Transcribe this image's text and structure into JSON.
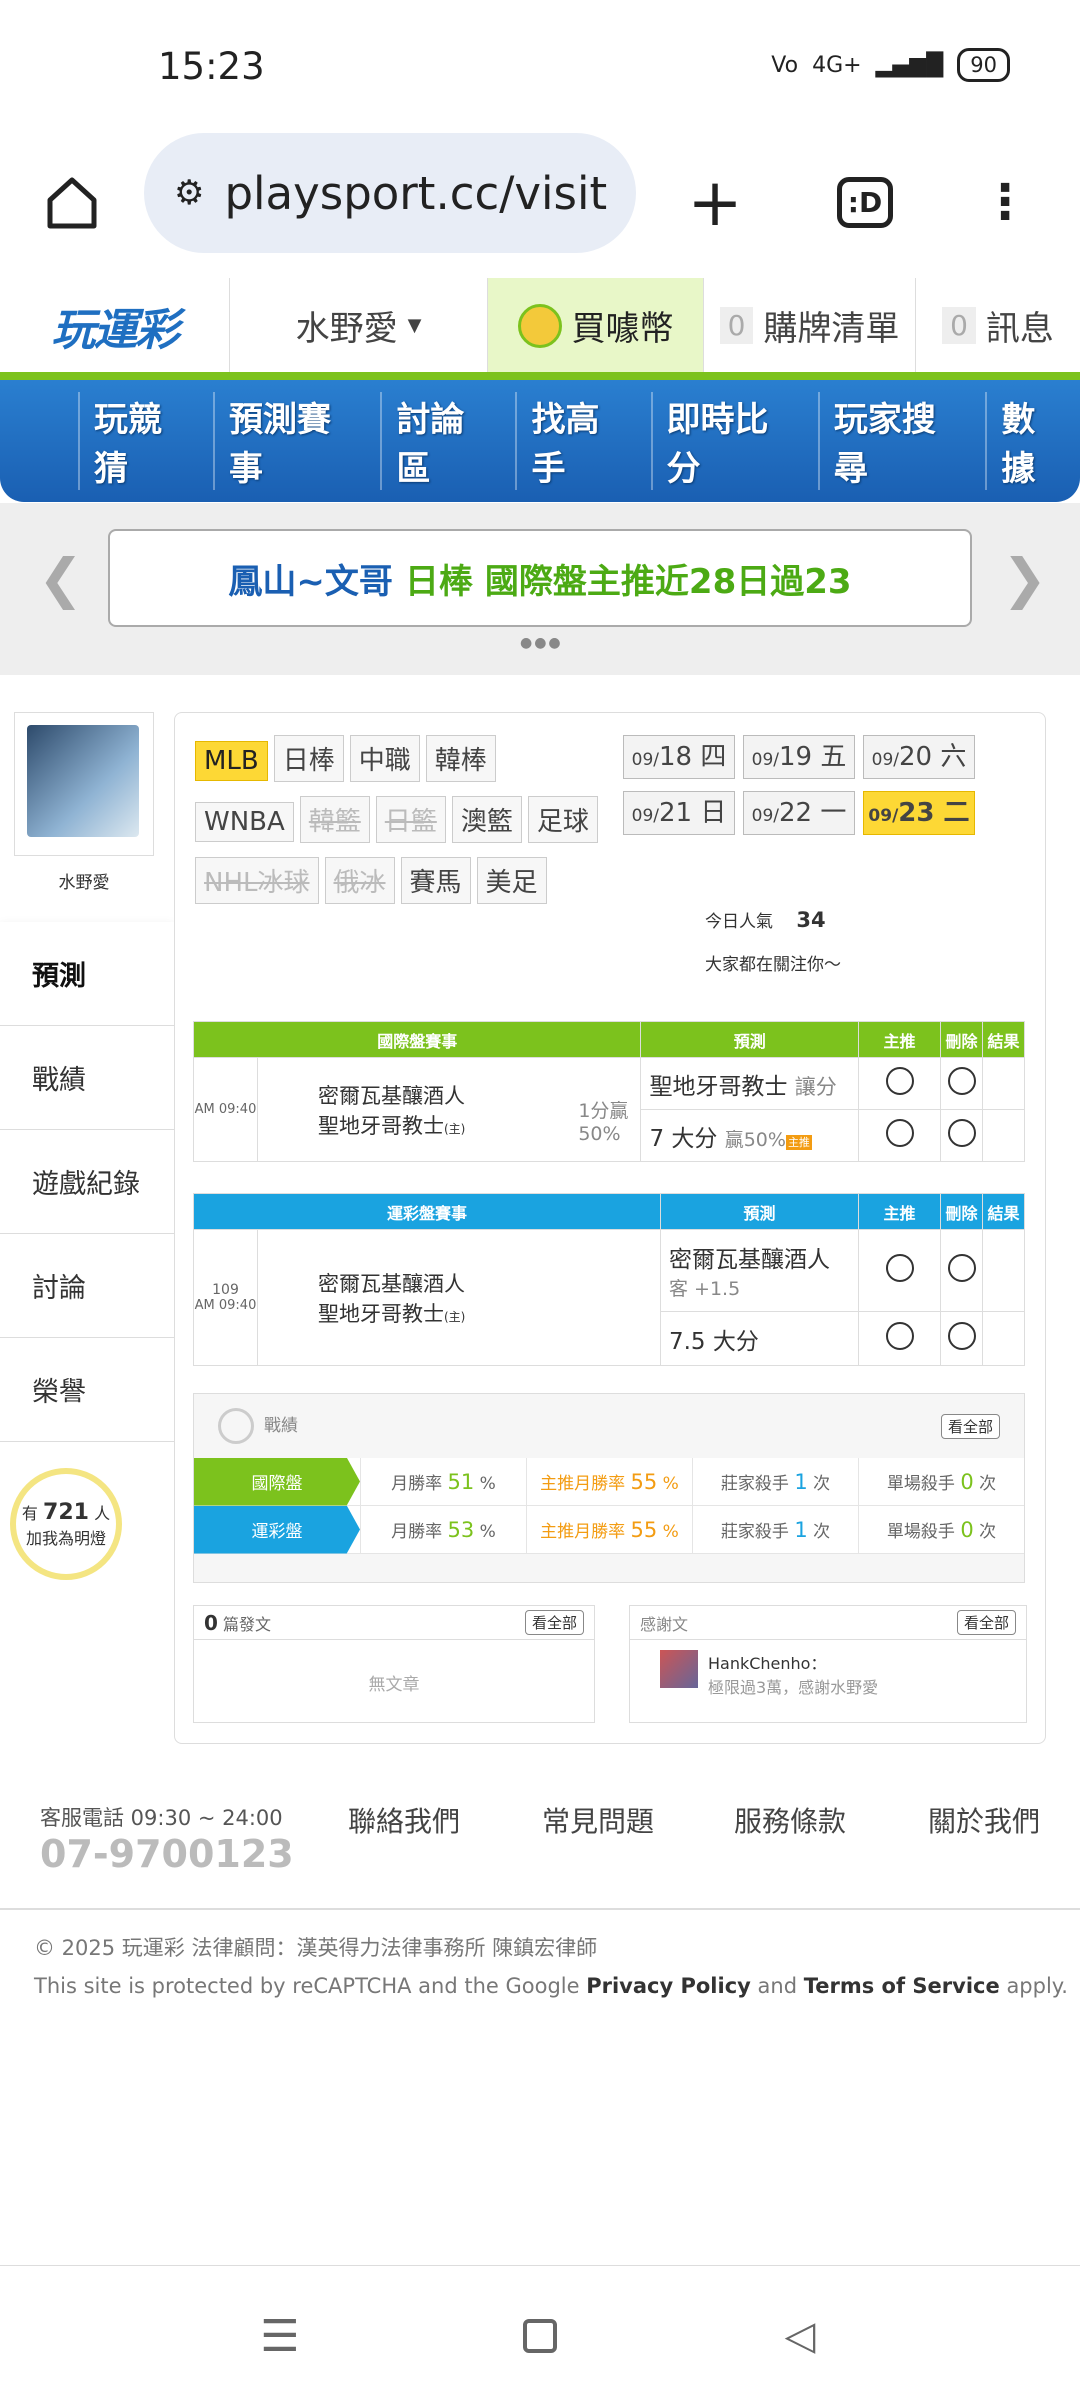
{
  "status": {
    "time": "15:23",
    "network": "4G+",
    "battery": "90"
  },
  "browser": {
    "url": "playsport.cc/visit",
    "tab_icon": ":D"
  },
  "site_header": {
    "logo": "玩運彩",
    "user": "水野愛",
    "buy_coin": "買噱幣",
    "cart_count": "0",
    "cart_label": "購牌清單",
    "msg_count": "0",
    "msg_label": "訊息"
  },
  "main_nav": [
    "玩競猜",
    "預測賽事",
    "討論區",
    "找高手",
    "即時比分",
    "玩家搜尋",
    "數據"
  ],
  "banner": {
    "name": "鳳山~文哥",
    "league": "日棒",
    "text": "國際盤主推近28日過23"
  },
  "profile": {
    "name": "水野愛"
  },
  "side_nav": [
    "預測",
    "戰績",
    "遊戲紀錄",
    "討論",
    "榮譽"
  ],
  "fans": {
    "prefix": "有",
    "count": "721",
    "suffix": "人",
    "sub": "加我為明燈"
  },
  "leagues": [
    {
      "label": "MLB",
      "state": "on"
    },
    {
      "label": "日棒",
      "state": ""
    },
    {
      "label": "中職",
      "state": ""
    },
    {
      "label": "韓棒",
      "state": ""
    },
    {
      "label": "WNBA",
      "state": ""
    },
    {
      "label": "韓籃",
      "state": "dis"
    },
    {
      "label": "日籃",
      "state": "dis"
    },
    {
      "label": "澳籃",
      "state": ""
    },
    {
      "label": "足球",
      "state": ""
    },
    {
      "label": "NHL冰球",
      "state": "dis"
    },
    {
      "label": "俄冰",
      "state": "dis"
    },
    {
      "label": "賽馬",
      "state": ""
    },
    {
      "label": "美足",
      "state": ""
    }
  ],
  "dates": [
    {
      "m": "09/",
      "d": "18",
      "w": "四",
      "on": false
    },
    {
      "m": "09/",
      "d": "19",
      "w": "五",
      "on": false
    },
    {
      "m": "09/",
      "d": "20",
      "w": "六",
      "on": false
    },
    {
      "m": "09/",
      "d": "21",
      "w": "日",
      "on": false
    },
    {
      "m": "09/",
      "d": "22",
      "w": "一",
      "on": false
    },
    {
      "m": "09/",
      "d": "23",
      "w": "二",
      "on": true
    }
  ],
  "popularity": {
    "label": "今日人氣",
    "value": "34",
    "sub": "大家都在關注你～"
  },
  "intl_table": {
    "title": "國際盤賽事",
    "col_predict": "預測",
    "col_main": "主推",
    "col_del": "刪除",
    "col_result": "結果",
    "time": "AM 09:40",
    "away": "密爾瓦基釀酒人",
    "home": "聖地牙哥教士",
    "home_tag": "(主)",
    "line1": "1分贏",
    "line2": "50%",
    "pick1": "聖地牙哥教士",
    "pick1_sub": "讓分",
    "pick2": "7 大分",
    "pick2_sub": "贏50%",
    "pick2_tag": "主推"
  },
  "lottery_table": {
    "title": "運彩盤賽事",
    "col_predict": "預測",
    "col_main": "主推",
    "col_del": "刪除",
    "col_result": "結果",
    "no": "109",
    "time": "AM 09:40",
    "away": "密爾瓦基釀酒人",
    "home": "聖地牙哥教士",
    "home_tag": "(主)",
    "pick1": "密爾瓦基釀酒人",
    "pick1_sub": "客 +1.5",
    "pick2": "7.5 大分"
  },
  "record": {
    "title": "戰績",
    "view_all": "看全部",
    "rows": [
      {
        "tag": "國際盤",
        "color": "#7cc21d",
        "win_label": "月勝率",
        "win": "51",
        "main_label": "主推月勝率",
        "main": "55",
        "kill_label": "莊家殺手",
        "kill": "1",
        "single_label": "單場殺手",
        "single": "0",
        "unit": "次"
      },
      {
        "tag": "運彩盤",
        "color": "#1aa3e0",
        "win_label": "月勝率",
        "win": "53",
        "main_label": "主推月勝率",
        "main": "55",
        "kill_label": "莊家殺手",
        "kill": "1",
        "single_label": "單場殺手",
        "single": "0",
        "unit": "次"
      }
    ]
  },
  "posts": {
    "count": "0",
    "label": "篇發文",
    "view_all": "看全部",
    "empty": "無文章"
  },
  "thanks": {
    "label": "感謝文",
    "view_all": "看全部",
    "user": "HankChenho：",
    "text": "極限過3萬，感謝水野愛"
  },
  "footer": {
    "phone_label": "客服電話 09:30 ~ 24:00",
    "phone": "07-9700123",
    "links": [
      "聯絡我們",
      "常見問題",
      "服務條款",
      "關於我們"
    ],
    "copyright": "© 2025 玩運彩 法律顧問：漢英得力法律事務所 陳鎮宏律師",
    "recaptcha_pre": "This site is protected by reCAPTCHA and the Google",
    "privacy": "Privacy Policy",
    "and": "and",
    "terms": "Terms of Service",
    "apply": "apply."
  }
}
